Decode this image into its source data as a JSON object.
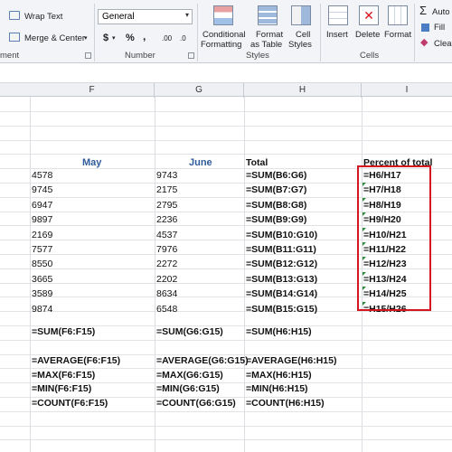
{
  "ribbon": {
    "wrap_text": "Wrap Text",
    "merge_center": "Merge & Center",
    "number_format": "General",
    "currency": "$",
    "percent": "%",
    "comma": ",",
    "inc_decimal": ".00",
    "dec_decimal": ".0",
    "conditional_formatting_1": "Conditional",
    "conditional_formatting_2": "Formatting",
    "format_as_table_1": "Format",
    "format_as_table_2": "as Table",
    "cell_styles_1": "Cell",
    "cell_styles_2": "Styles",
    "insert": "Insert",
    "delete": "Delete",
    "format": "Format",
    "autosum": "Auto",
    "fill": "Fill",
    "clear": "Clear",
    "group_alignment": "ment",
    "group_number": "Number",
    "group_styles": "Styles",
    "group_cells": "Cells"
  },
  "columns": [
    "F",
    "G",
    "H",
    "I"
  ],
  "headers": {
    "may": "May",
    "june": "June",
    "total": "Total",
    "percent": "Percent of total"
  },
  "rows": [
    {
      "f": "4578",
      "g": "9743",
      "h": "=SUM(B6:G6)",
      "i": "=H6/H17"
    },
    {
      "f": "9745",
      "g": "2175",
      "h": "=SUM(B7:G7)",
      "i": "=H7/H18"
    },
    {
      "f": "6947",
      "g": "2795",
      "h": "=SUM(B8:G8)",
      "i": "=H8/H19"
    },
    {
      "f": "9897",
      "g": "2236",
      "h": "=SUM(B9:G9)",
      "i": "=H9/H20"
    },
    {
      "f": "2169",
      "g": "4537",
      "h": "=SUM(B10:G10)",
      "i": "=H10/H21"
    },
    {
      "f": "7577",
      "g": "7976",
      "h": "=SUM(B11:G11)",
      "i": "=H11/H22"
    },
    {
      "f": "8550",
      "g": "2272",
      "h": "=SUM(B12:G12)",
      "i": "=H12/H23"
    },
    {
      "f": "3665",
      "g": "2202",
      "h": "=SUM(B13:G13)",
      "i": "=H13/H24"
    },
    {
      "f": "3589",
      "g": "8634",
      "h": "=SUM(B14:G14)",
      "i": "=H14/H25"
    },
    {
      "f": "9874",
      "g": "6548",
      "h": "=SUM(B15:G15)",
      "i": "=H15/H26"
    }
  ],
  "summary": {
    "sum": {
      "f": "=SUM(F6:F15)",
      "g": "=SUM(G6:G15)",
      "h": "=SUM(H6:H15)"
    },
    "average": {
      "f": "=AVERAGE(F6:F15)",
      "g": "=AVERAGE(G6:G15)",
      "h": "=AVERAGE(H6:H15)"
    },
    "max": {
      "f": "=MAX(F6:F15)",
      "g": "=MAX(G6:G15)",
      "h": "=MAX(H6:H15)"
    },
    "min": {
      "f": "=MIN(F6:F15)",
      "g": "=MIN(G6:G15)",
      "h": "=MIN(H6:H15)"
    },
    "count": {
      "f": "=COUNT(F6:F15)",
      "g": "=COUNT(G6:G15)",
      "h": "=COUNT(H6:H15)"
    }
  },
  "colors": {
    "header_blue": "#2e5b9a",
    "highlight_red": "#d4171e",
    "error_triangle": "#2e8b3a"
  }
}
